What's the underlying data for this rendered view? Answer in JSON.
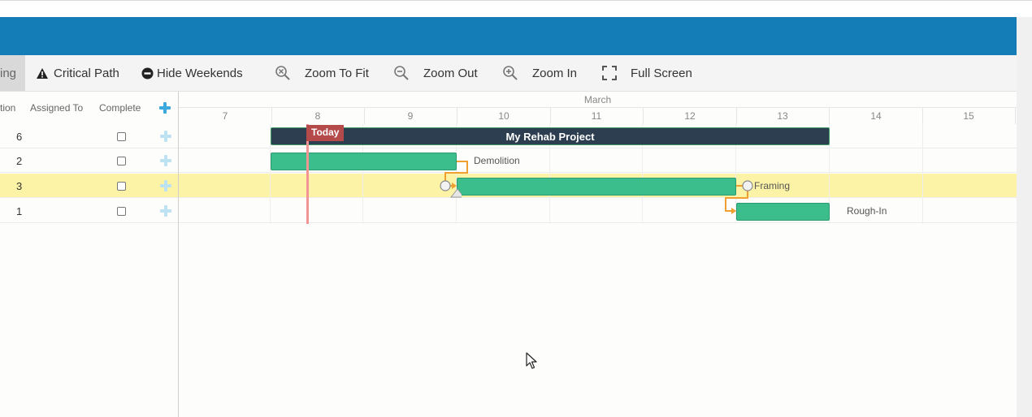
{
  "toolbar": {
    "items": [
      {
        "label": "ing",
        "icon": "scheduling-partial",
        "active": true
      },
      {
        "label": "Critical Path",
        "icon": "warning-triangle-icon"
      },
      {
        "label": "Hide Weekends",
        "icon": "minus-circle-icon"
      },
      {
        "label": "Zoom To Fit",
        "icon": "zoom-fit-icon"
      },
      {
        "label": "Zoom Out",
        "icon": "zoom-out-icon"
      },
      {
        "label": "Zoom In",
        "icon": "zoom-in-icon"
      },
      {
        "label": "Full Screen",
        "icon": "fullscreen-icon"
      }
    ]
  },
  "grid": {
    "columns": {
      "duration": "tion",
      "assigned": "Assigned To",
      "complete": "Complete"
    },
    "rows": [
      {
        "duration": "6",
        "complete": false
      },
      {
        "duration": "2",
        "complete": false
      },
      {
        "duration": "3",
        "complete": false,
        "highlighted": true
      },
      {
        "duration": "1",
        "complete": false
      }
    ]
  },
  "timeline": {
    "month": "March",
    "days": [
      "7",
      "8",
      "9",
      "10",
      "11",
      "12",
      "13",
      "14",
      "15"
    ],
    "today_label": "Today",
    "tasks": [
      {
        "name": "My Rehab Project",
        "type": "summary"
      },
      {
        "name": "Demolition",
        "type": "task"
      },
      {
        "name": "Framing",
        "type": "task"
      },
      {
        "name": "Rough-In",
        "type": "task"
      }
    ]
  },
  "colors": {
    "header": "#147cb7",
    "task_bar": "#3bbd8c",
    "summary_bar": "#2d3e50",
    "today": "#f29595",
    "dependency": "#f0a030",
    "highlight_row": "#fdf3a6"
  }
}
